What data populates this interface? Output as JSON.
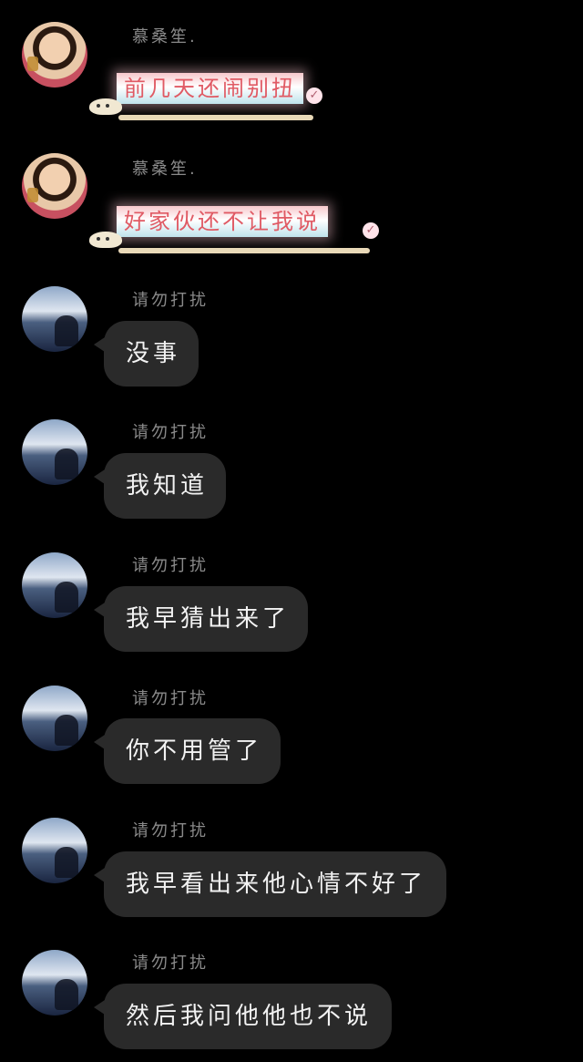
{
  "messages": [
    {
      "sender": "慕桑笙.",
      "text": "前几天还闹别扭",
      "style": "sticker",
      "avatar": "girl-avatar"
    },
    {
      "sender": "慕桑笙.",
      "text": "好家伙还不让我说",
      "style": "sticker",
      "avatar": "girl-avatar"
    },
    {
      "sender": "请勿打扰",
      "text": "没事",
      "style": "bubble",
      "avatar": "sky-avatar"
    },
    {
      "sender": "请勿打扰",
      "text": "我知道",
      "style": "bubble",
      "avatar": "sky-avatar"
    },
    {
      "sender": "请勿打扰",
      "text": "我早猜出来了",
      "style": "bubble",
      "avatar": "sky-avatar"
    },
    {
      "sender": "请勿打扰",
      "text": "你不用管了",
      "style": "bubble",
      "avatar": "sky-avatar"
    },
    {
      "sender": "请勿打扰",
      "text": "我早看出来他心情不好了",
      "style": "bubble",
      "avatar": "sky-avatar"
    },
    {
      "sender": "请勿打扰",
      "text": "然后我问他他也不说",
      "style": "bubble",
      "avatar": "sky-avatar"
    }
  ],
  "colors": {
    "background": "#000000",
    "bubble": "#2a2a2a",
    "bubble_text": "#f2f2f2",
    "sender_text": "#8a8a8a",
    "sticker_text": "#e05a64"
  }
}
